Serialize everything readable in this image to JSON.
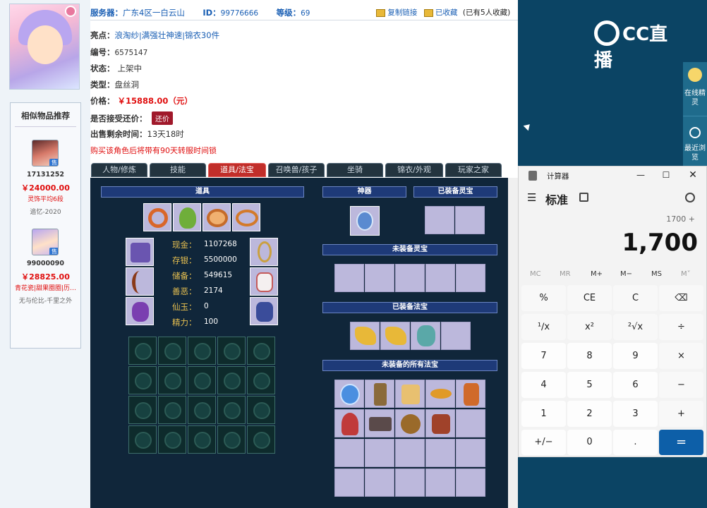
{
  "listing": {
    "server_label": "服务器：",
    "server_value": "广东4区一白云山",
    "id_label": "ID：",
    "id_value": "99776666",
    "level_label": "等级：",
    "level_value": "69",
    "copy_link": "复制链接",
    "favorited": "已收藏",
    "fav_count": "(已有5人收藏)",
    "highlights_label": "亮点：",
    "highlights": [
      "浪淘纱",
      "满强壮神速",
      "锦衣30件"
    ],
    "number_label": "编号：",
    "number_value": "6575147",
    "status_label": "状态：",
    "status_value": "上架中",
    "type_label": "类型：",
    "type_value": "盘丝洞",
    "price_label": "价格：",
    "price_value": "￥15888.00（元）",
    "bargain_label": "是否接受还价：",
    "bargain_button": "还价",
    "remaining_label": "出售剩余时间：",
    "remaining_value": "13天18时",
    "notice": "购买该角色后将带有90天转服时间锁"
  },
  "similar": {
    "title": "相似物品推荐",
    "items": [
      {
        "id": "17131252",
        "price": "￥24000.00",
        "tag": "灵饰平均6段",
        "note": "追忆-2020",
        "badge": "售"
      },
      {
        "id": "99000090",
        "price": "￥28825.00",
        "tag": "青花瓷|甜果圈圈|历…",
        "note": "无与伦比-千里之外",
        "badge": "售"
      }
    ]
  },
  "tabs": [
    "人物/修炼",
    "技能",
    "道具/法宝",
    "召唤兽/孩子",
    "坐骑",
    "锦衣/外观",
    "玩家之家"
  ],
  "active_tab": "道具/法宝",
  "panel": {
    "items_header": "道具",
    "artifact_header": "神器",
    "equipped_spirit_header": "已装备灵宝",
    "unequipped_spirit_header": "未装备灵宝",
    "equipped_fabao_header": "已装备法宝",
    "all_fabao_header": "未装备的所有法宝",
    "stats": [
      {
        "label": "现金：",
        "value": "1107268"
      },
      {
        "label": "存银：",
        "value": "5500000"
      },
      {
        "label": "储备：",
        "value": "549615"
      },
      {
        "label": "善恶：",
        "value": "2174"
      },
      {
        "label": "仙玉：",
        "value": "0"
      },
      {
        "label": "精力：",
        "value": "100"
      }
    ]
  },
  "brand": {
    "logo_text": "CC直播",
    "online_spirit": "在线精灵",
    "recent_browse": "最近浏览"
  },
  "calculator": {
    "title": "计算器",
    "mode": "标准",
    "expression": "1700 +",
    "display": "1,700",
    "memory": [
      "MC",
      "MR",
      "M+",
      "M−",
      "MS",
      "M˅"
    ],
    "keys": [
      [
        "%",
        "CE",
        "C",
        "⌫"
      ],
      [
        "¹∕x",
        "x²",
        "²√x",
        "÷"
      ],
      [
        "7",
        "8",
        "9",
        "×"
      ],
      [
        "4",
        "5",
        "6",
        "−"
      ],
      [
        "1",
        "2",
        "3",
        "+"
      ],
      [
        "+/−",
        "0",
        ".",
        "="
      ]
    ]
  }
}
